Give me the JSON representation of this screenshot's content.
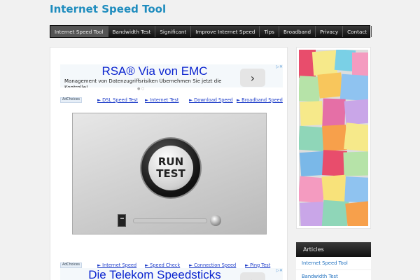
{
  "site": {
    "title": "Internet Speed Tool"
  },
  "nav": {
    "items": [
      {
        "label": "Internet Speed Tool"
      },
      {
        "label": "Bandwidth Test"
      },
      {
        "label": "Significant"
      },
      {
        "label": "Improve Internet Speed"
      },
      {
        "label": "Tips"
      },
      {
        "label": "Broadband"
      },
      {
        "label": "Privacy"
      },
      {
        "label": "Contact"
      }
    ]
  },
  "ad_top": {
    "title": "RSA® Via von EMC",
    "text": "Management von Datenzugriffsrisiken Übernehmen Sie jetzt die Kontrolle!",
    "arrow": "›",
    "corner": "▷✕"
  },
  "links_top": {
    "adchoices": "AdChoices",
    "items": [
      {
        "label": "► DSL Speed Test"
      },
      {
        "label": "► Internet Test"
      },
      {
        "label": "► Download Speed"
      },
      {
        "label": "► Broadband Speed"
      }
    ]
  },
  "speed_test": {
    "button_line1": "RUN",
    "button_line2": "TEST",
    "progress": 0
  },
  "links_bottom": {
    "adchoices": "AdChoices",
    "items": [
      {
        "label": "► Internet Speed"
      },
      {
        "label": "► Speed Check"
      },
      {
        "label": "► Connection Speed"
      },
      {
        "label": "► Ping Test"
      }
    ]
  },
  "ad_bottom": {
    "title": "Die Telekom Speedsticks",
    "arrow": "›",
    "corner": "▷✕"
  },
  "sidebar": {
    "widget_title": "Articles",
    "links": [
      {
        "label": "Internet Speed Tool"
      },
      {
        "label": "Bandwidth Test"
      }
    ]
  },
  "colors": {
    "accent": "#1e8cbe",
    "ad_title": "#0b24cf",
    "link": "#1f3ec9"
  }
}
